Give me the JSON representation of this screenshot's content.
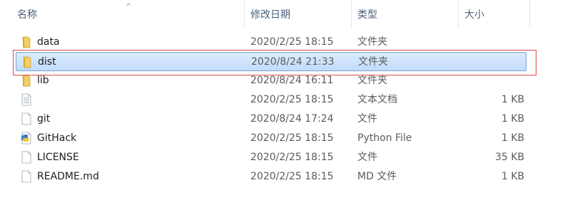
{
  "header": {
    "name": "名称",
    "modified": "修改日期",
    "type": "类型",
    "size": "大小",
    "sort_arrow": "^"
  },
  "files": [
    {
      "name": "data",
      "date": "2020/2/25 18:15",
      "type": "文件夹",
      "size": "",
      "icon": "folder-icon"
    },
    {
      "name": "dist",
      "date": "2020/8/24 21:33",
      "type": "文件夹",
      "size": "",
      "icon": "folder-icon",
      "selected": true
    },
    {
      "name": "lib",
      "date": "2020/8/24 16:11",
      "type": "文件夹",
      "size": "",
      "icon": "folder-icon"
    },
    {
      "name": "",
      "date": "2020/2/25 18:15",
      "type": "文本文档",
      "size": "1 KB",
      "icon": "text-document-icon"
    },
    {
      "name": "git",
      "date": "2020/8/24 17:24",
      "type": "文件",
      "size": "1 KB",
      "icon": "file-icon"
    },
    {
      "name": "GitHack",
      "date": "2020/2/25 18:15",
      "type": "Python File",
      "size": "1 KB",
      "icon": "python-file-icon"
    },
    {
      "name": "LICENSE",
      "date": "2020/2/25 18:15",
      "type": "文件",
      "size": "35 KB",
      "icon": "file-icon"
    },
    {
      "name": "README.md",
      "date": "2020/2/25 18:15",
      "type": "MD 文件",
      "size": "1 KB",
      "icon": "file-icon"
    }
  ]
}
